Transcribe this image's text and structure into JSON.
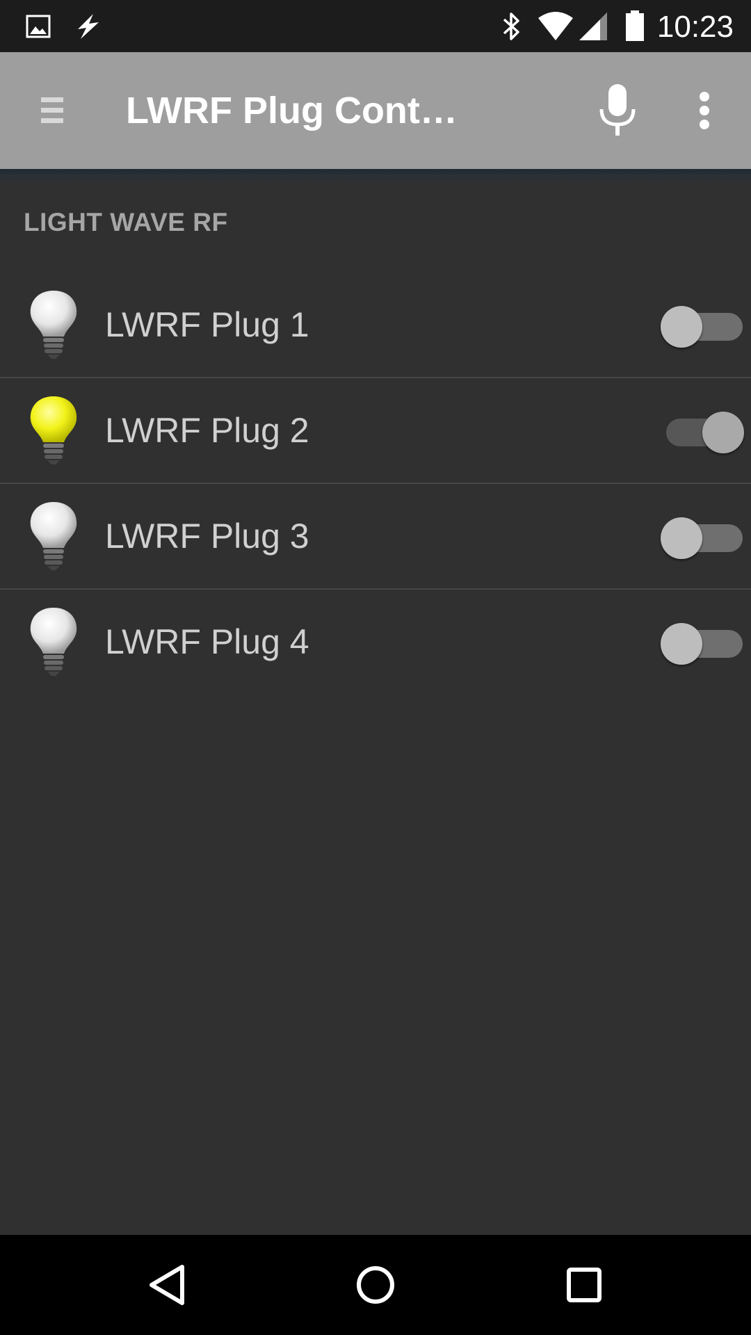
{
  "status_bar": {
    "time": "10:23",
    "icons": [
      "image-notification-icon",
      "flash-notification-icon",
      "bluetooth-icon",
      "wifi-icon",
      "cell-signal-icon",
      "battery-icon"
    ]
  },
  "action_bar": {
    "title": "LWRF Plug Cont…",
    "icons": [
      "drawer-menu-icon",
      "microphone-icon",
      "overflow-menu-icon"
    ]
  },
  "section": {
    "header": "LIGHT WAVE RF"
  },
  "plugs": [
    {
      "label": "LWRF Plug 1",
      "on": false
    },
    {
      "label": "LWRF Plug 2",
      "on": true
    },
    {
      "label": "LWRF Plug 3",
      "on": false
    },
    {
      "label": "LWRF Plug 4",
      "on": false
    }
  ],
  "colors": {
    "background": "#303030",
    "action_bar": "#9e9e9e",
    "bulb_on": "#f2f21a",
    "bulb_off": "#e6e6e6"
  },
  "nav_bar": {
    "icons": [
      "back-icon",
      "home-icon",
      "recents-icon"
    ]
  }
}
